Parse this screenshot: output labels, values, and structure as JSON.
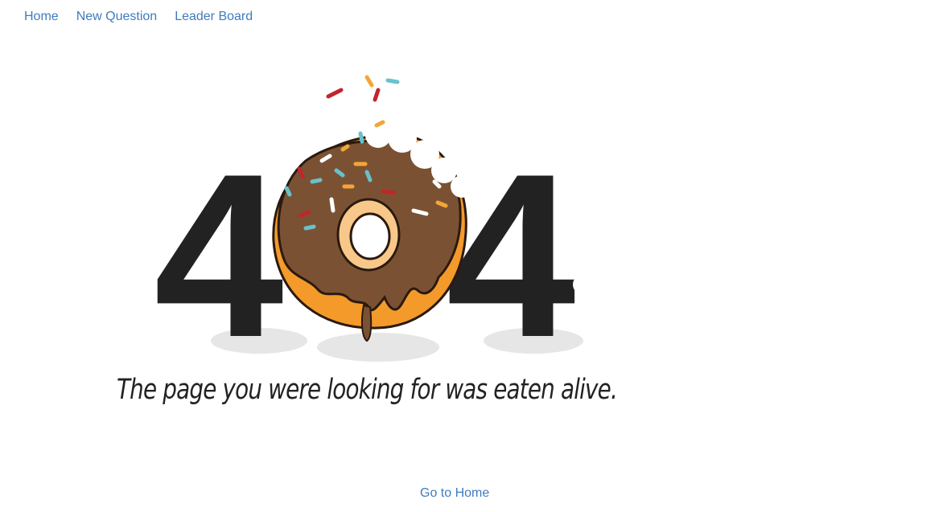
{
  "nav": {
    "items": [
      {
        "label": "Home"
      },
      {
        "label": "New Question"
      },
      {
        "label": "Leader Board"
      }
    ]
  },
  "illustration": {
    "first_digit": "4",
    "last_digit": "4",
    "tagline": "The page you were looking for was eaten alive."
  },
  "footer": {
    "go_home_label": "Go to Home"
  },
  "colors": {
    "link": "#3f7bbf",
    "digit": "#222222",
    "donut_dough": "#f39a2a",
    "donut_glaze": "#7a5233",
    "shadow": "#e4e4e4"
  }
}
